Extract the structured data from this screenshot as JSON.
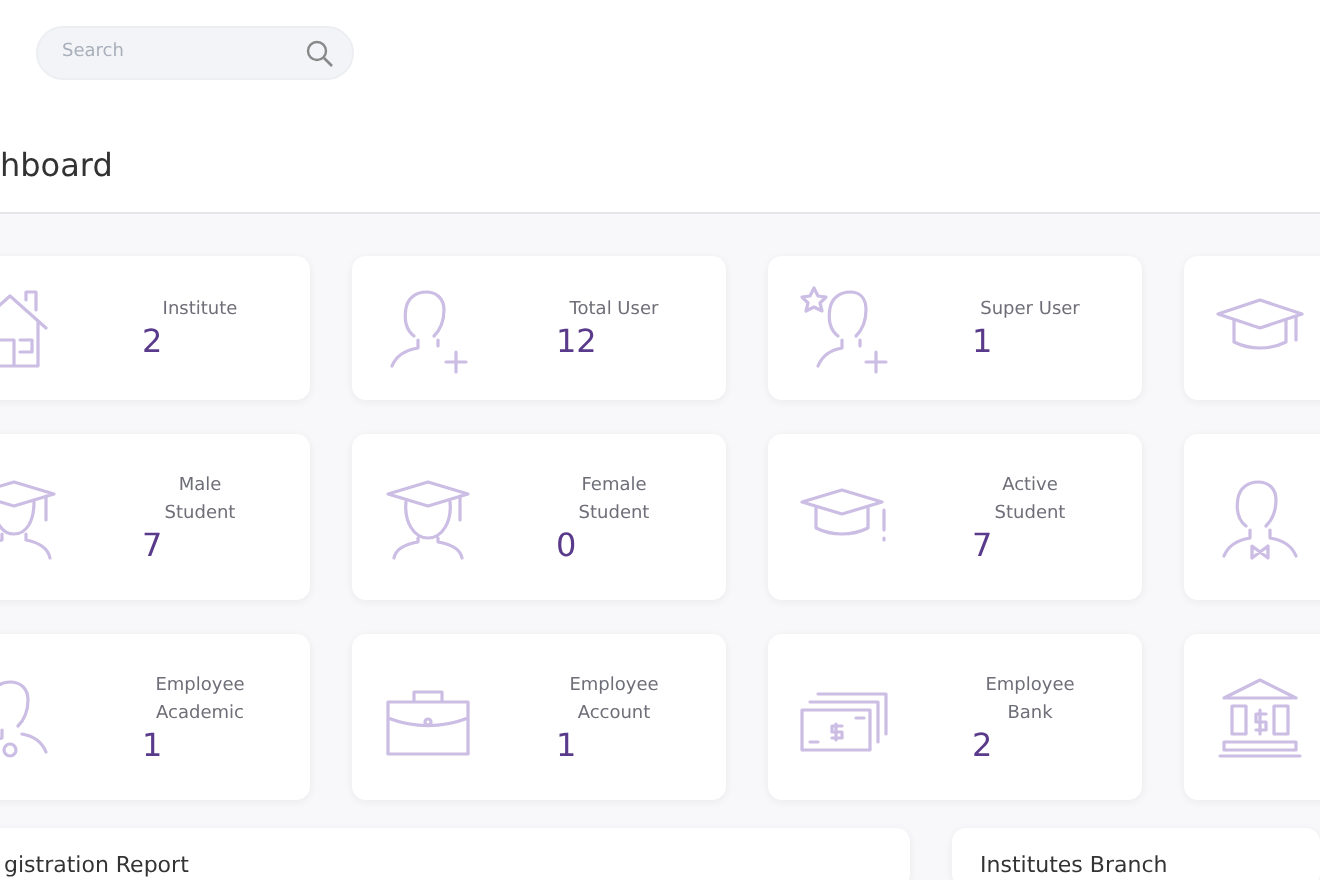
{
  "search": {
    "placeholder": "Search"
  },
  "page_title": "hboard",
  "stat_cards": [
    {
      "kind": "stat",
      "label": "Institute",
      "value": "2"
    },
    {
      "kind": "stat",
      "label": "Total User",
      "value": "12"
    },
    {
      "kind": "stat",
      "label": "Super User",
      "value": "1"
    },
    {
      "kind": "icon_only"
    },
    {
      "kind": "stat",
      "label": "Male Student",
      "value": "7"
    },
    {
      "kind": "stat",
      "label": "Female Student",
      "value": "0"
    },
    {
      "kind": "stat",
      "label": "Active Student",
      "value": "7"
    },
    {
      "kind": "icon_only"
    },
    {
      "kind": "stat",
      "label": "Employee Academic",
      "value": "1"
    },
    {
      "kind": "stat",
      "label": "Employee Account",
      "value": "1"
    },
    {
      "kind": "stat",
      "label": "Employee Bank",
      "value": "2"
    },
    {
      "kind": "icon_only"
    }
  ],
  "panels": [
    {
      "title": "gistration Report"
    },
    {
      "title": "Institutes Branch"
    }
  ]
}
